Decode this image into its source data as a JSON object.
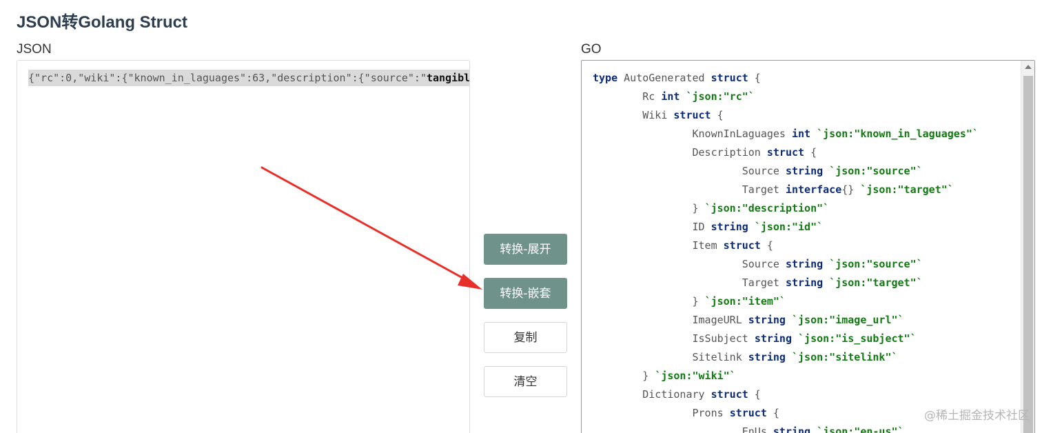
{
  "page": {
    "title": "JSON转Golang Struct"
  },
  "json_panel": {
    "label": "JSON",
    "line_prefix": "{\"rc\":0,\"wiki\":{\"known_in_laguages\":63,\"description\":{\"source\":\"",
    "line_bold": "tangible"
  },
  "buttons": {
    "convert_expand": "转换-展开",
    "convert_nested": "转换-嵌套",
    "copy": "复制",
    "clear": "清空"
  },
  "go_panel": {
    "label": "GO",
    "lines": [
      [
        [
          "kw",
          "type"
        ],
        [
          "id",
          " AutoGenerated "
        ],
        [
          "kw",
          "struct"
        ],
        [
          "pu",
          " {"
        ]
      ],
      [
        [
          "id",
          "        Rc "
        ],
        [
          "ty",
          "int"
        ],
        [
          "pu",
          " "
        ],
        [
          "tag",
          "`json:\"rc\"`"
        ]
      ],
      [
        [
          "id",
          "        Wiki "
        ],
        [
          "kw",
          "struct"
        ],
        [
          "pu",
          " {"
        ]
      ],
      [
        [
          "id",
          "                KnownInLaguages "
        ],
        [
          "ty",
          "int"
        ],
        [
          "pu",
          " "
        ],
        [
          "tag",
          "`json:\"known_in_laguages\"`"
        ]
      ],
      [
        [
          "id",
          "                Description "
        ],
        [
          "kw",
          "struct"
        ],
        [
          "pu",
          " {"
        ]
      ],
      [
        [
          "id",
          "                        Source "
        ],
        [
          "ty",
          "string"
        ],
        [
          "pu",
          " "
        ],
        [
          "tag",
          "`json:\"source\"`"
        ]
      ],
      [
        [
          "id",
          "                        Target "
        ],
        [
          "ty",
          "interface"
        ],
        [
          "pu",
          "{} "
        ],
        [
          "tag",
          "`json:\"target\"`"
        ]
      ],
      [
        [
          "pu",
          "                } "
        ],
        [
          "tag",
          "`json:\"description\"`"
        ]
      ],
      [
        [
          "id",
          "                ID "
        ],
        [
          "ty",
          "string"
        ],
        [
          "pu",
          " "
        ],
        [
          "tag",
          "`json:\"id\"`"
        ]
      ],
      [
        [
          "id",
          "                Item "
        ],
        [
          "kw",
          "struct"
        ],
        [
          "pu",
          " {"
        ]
      ],
      [
        [
          "id",
          "                        Source "
        ],
        [
          "ty",
          "string"
        ],
        [
          "pu",
          " "
        ],
        [
          "tag",
          "`json:\"source\"`"
        ]
      ],
      [
        [
          "id",
          "                        Target "
        ],
        [
          "ty",
          "string"
        ],
        [
          "pu",
          " "
        ],
        [
          "tag",
          "`json:\"target\"`"
        ]
      ],
      [
        [
          "pu",
          "                } "
        ],
        [
          "tag",
          "`json:\"item\"`"
        ]
      ],
      [
        [
          "id",
          "                ImageURL "
        ],
        [
          "ty",
          "string"
        ],
        [
          "pu",
          " "
        ],
        [
          "tag",
          "`json:\"image_url\"`"
        ]
      ],
      [
        [
          "id",
          "                IsSubject "
        ],
        [
          "ty",
          "string"
        ],
        [
          "pu",
          " "
        ],
        [
          "tag",
          "`json:\"is_subject\"`"
        ]
      ],
      [
        [
          "id",
          "                Sitelink "
        ],
        [
          "ty",
          "string"
        ],
        [
          "pu",
          " "
        ],
        [
          "tag",
          "`json:\"sitelink\"`"
        ]
      ],
      [
        [
          "pu",
          "        } "
        ],
        [
          "tag",
          "`json:\"wiki\"`"
        ]
      ],
      [
        [
          "id",
          "        Dictionary "
        ],
        [
          "kw",
          "struct"
        ],
        [
          "pu",
          " {"
        ]
      ],
      [
        [
          "id",
          "                Prons "
        ],
        [
          "kw",
          "struct"
        ],
        [
          "pu",
          " {"
        ]
      ],
      [
        [
          "id",
          "                        EnUs "
        ],
        [
          "ty",
          "string"
        ],
        [
          "pu",
          " "
        ],
        [
          "tag",
          "`json:\"en-us\"`"
        ]
      ]
    ]
  },
  "watermark": "@稀土掘金技术社区",
  "colors": {
    "primary_button": "#6f938b",
    "keyword": "#0b2a78",
    "tag": "#117a11",
    "arrow": "#e8302a"
  }
}
